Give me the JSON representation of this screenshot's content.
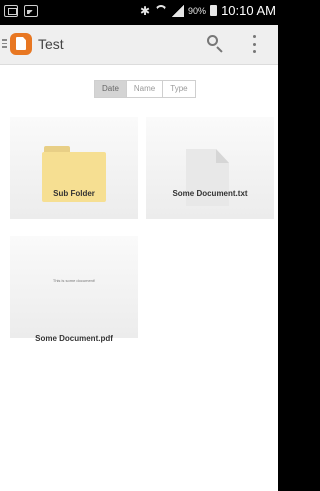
{
  "status_bar": {
    "left_icons": [
      "photo-icon",
      "picture-icon"
    ],
    "battery_percent": "90%",
    "time": "10:10 AM"
  },
  "action_bar": {
    "title": "Test",
    "app_icon": "document-app-logo",
    "actions": [
      "search-icon",
      "overflow-menu-icon"
    ]
  },
  "sort_tabs": {
    "options": [
      {
        "label": "Date",
        "selected": true
      },
      {
        "label": "Name",
        "selected": false
      },
      {
        "label": "Type",
        "selected": false
      }
    ]
  },
  "items": [
    {
      "label": "Sub Folder",
      "kind": "folder"
    },
    {
      "label": "Some Document.txt",
      "kind": "text-document"
    },
    {
      "label": "Some Document.pdf",
      "kind": "pdf-document",
      "preview_text": "This is some document!"
    }
  ],
  "colors": {
    "accent_orange": "#e87722",
    "folder_yellow": "#f6df92",
    "status_bar": "#000000",
    "action_bar": "#efefef"
  }
}
